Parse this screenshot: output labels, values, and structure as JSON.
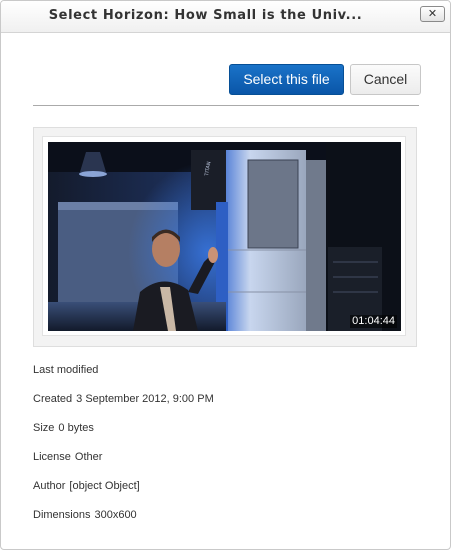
{
  "dialog": {
    "title": "Select Horizon: How Small is the Univ...",
    "close_label": "✕"
  },
  "actions": {
    "select_label": "Select this file",
    "cancel_label": "Cancel"
  },
  "preview": {
    "duration": "01:04:44",
    "server_brand": "TITAN"
  },
  "details": [
    {
      "label": "Last modified",
      "value": ""
    },
    {
      "label": "Created",
      "value": "3 September 2012, 9:00 PM"
    },
    {
      "label": "Size",
      "value": "0 bytes"
    },
    {
      "label": "License",
      "value": "Other"
    },
    {
      "label": "Author",
      "value": "[object Object]"
    },
    {
      "label": "Dimensions",
      "value": "300x600"
    }
  ],
  "colors": {
    "primary_button": "#0a56a8",
    "text": "#333333"
  }
}
